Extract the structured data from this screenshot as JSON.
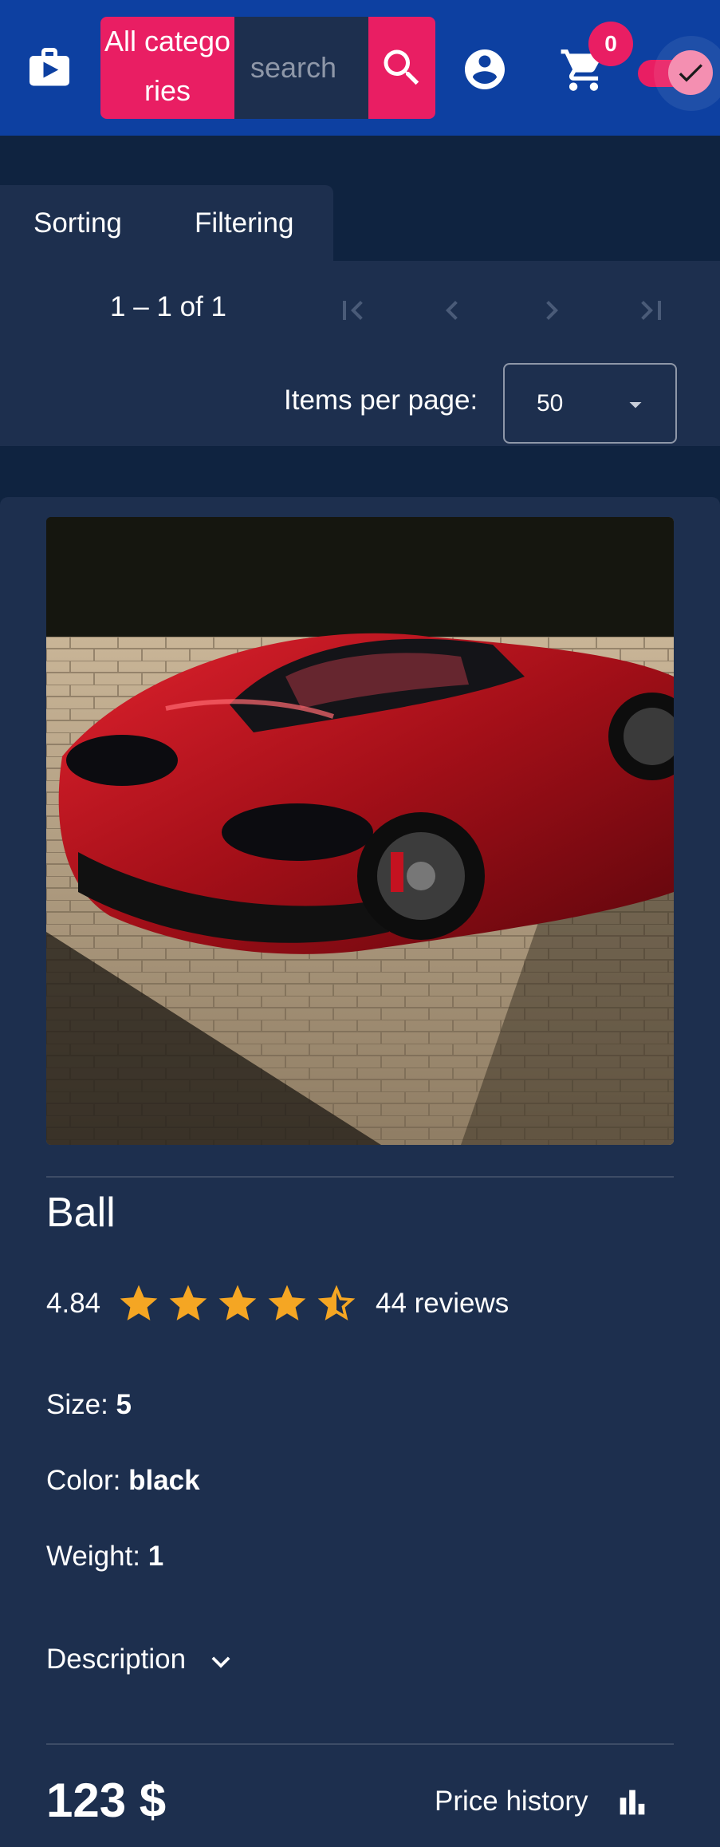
{
  "header": {
    "category_button_label": "All categories",
    "search_placeholder": "search",
    "cart_count": "0",
    "theme_toggle_on": true,
    "colors": {
      "bar": "#0d40a1",
      "accent": "#e91e63"
    },
    "icons": [
      "shop-icon",
      "search-icon",
      "account-icon",
      "cart-icon",
      "check-icon"
    ]
  },
  "toolbar": {
    "sorting_label": "Sorting",
    "filtering_label": "Filtering"
  },
  "paginator": {
    "range_label": "1 – 1 of 1",
    "items_per_page_label": "Items per page:",
    "items_per_page_value": "50",
    "icons": [
      "first-page-icon",
      "previous-page-icon",
      "next-page-icon",
      "last-page-icon",
      "dropdown-arrow-icon"
    ]
  },
  "product": {
    "image_subject": "red sports car",
    "name": "Ball",
    "rating": "4.84",
    "rating_stars": 4.5,
    "reviews_label": "44 reviews",
    "size_label": "Size:",
    "size_value": "5",
    "color_label": "Color:",
    "color_value": "black",
    "weight_label": "Weight:",
    "weight_value": "1",
    "description_label": "Description",
    "price": "123 $",
    "price_history_label": "Price history"
  },
  "colors": {
    "page_background": "#0f2340",
    "card_background": "#1d2f4e",
    "star": "#f5a623"
  }
}
